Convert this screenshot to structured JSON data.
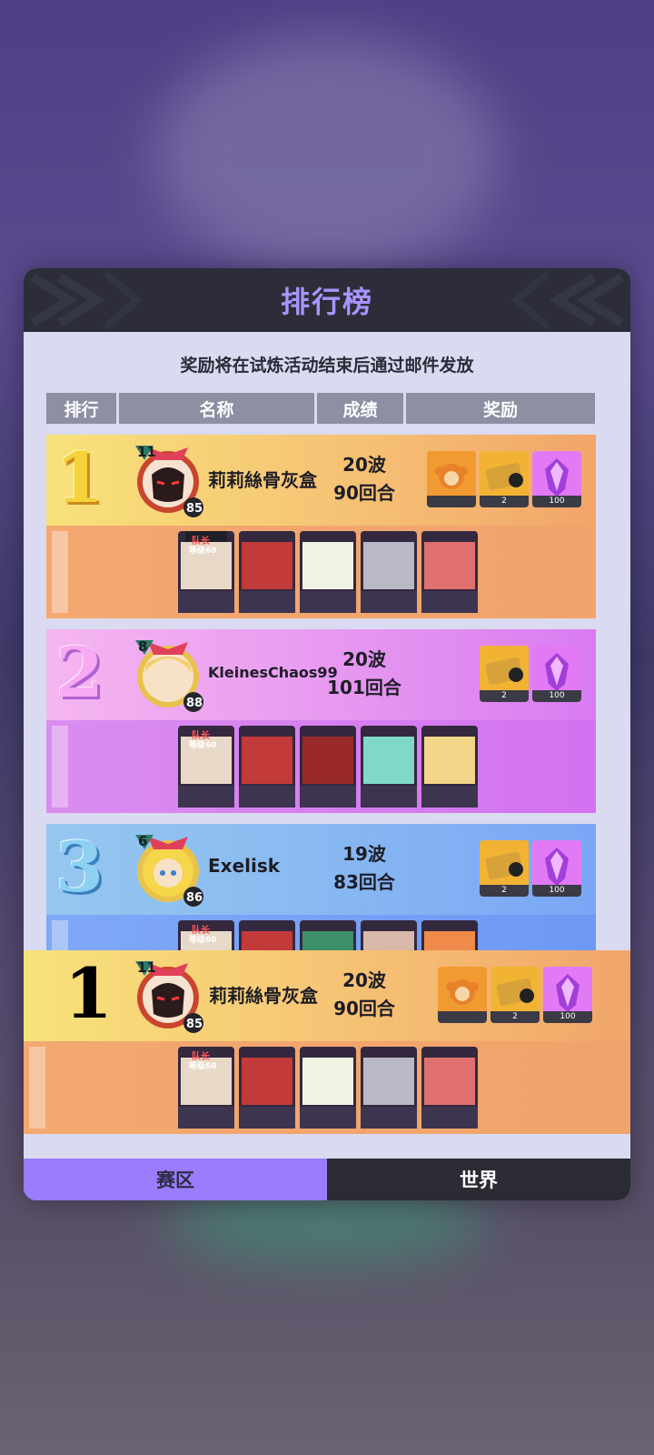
{
  "title": "排行榜",
  "notice": "奖励将在试炼活动结束后通过邮件发放",
  "columns": [
    "排行",
    "名称",
    "成绩",
    "奖励"
  ],
  "captain_label": "队长",
  "hero_level_label": "等级60",
  "entries": [
    {
      "rank": "1",
      "level": "11",
      "avatar_num": "85",
      "name": "莉莉絲骨灰盒",
      "waves": "20波",
      "rounds": "90回合",
      "rewards": [
        {
          "icon": "monkey-doll-icon",
          "count": ""
        },
        {
          "icon": "ticket-icon",
          "count": "2"
        },
        {
          "icon": "purple-crystal-icon",
          "count": "100"
        }
      ]
    },
    {
      "rank": "2",
      "level": "8",
      "avatar_num": "88",
      "name": "KleinesChaos99",
      "waves": "20波",
      "rounds": "101回合",
      "rewards": [
        {
          "icon": "ticket-icon",
          "count": "2"
        },
        {
          "icon": "purple-crystal-icon",
          "count": "100"
        }
      ]
    },
    {
      "rank": "3",
      "level": "6",
      "avatar_num": "86",
      "name": "Exelisk",
      "waves": "19波",
      "rounds": "83回合",
      "rewards": [
        {
          "icon": "ticket-icon",
          "count": "2"
        },
        {
          "icon": "purple-crystal-icon",
          "count": "100"
        }
      ]
    }
  ],
  "my_entry": {
    "rank": "1",
    "level": "11",
    "avatar_num": "85",
    "name": "莉莉絲骨灰盒",
    "waves": "20波",
    "rounds": "90回合",
    "rewards": [
      {
        "icon": "monkey-doll-icon",
        "count": ""
      },
      {
        "icon": "ticket-icon",
        "count": "2"
      },
      {
        "icon": "purple-crystal-icon",
        "count": "100"
      }
    ]
  },
  "tabs": {
    "region": "赛区",
    "world": "世界"
  },
  "colors": {
    "accent": "#9a7cfc",
    "title": "#a993ff",
    "rank1": "#f6c876",
    "rank2": "#e89af0",
    "rank3": "#88b9f2"
  }
}
